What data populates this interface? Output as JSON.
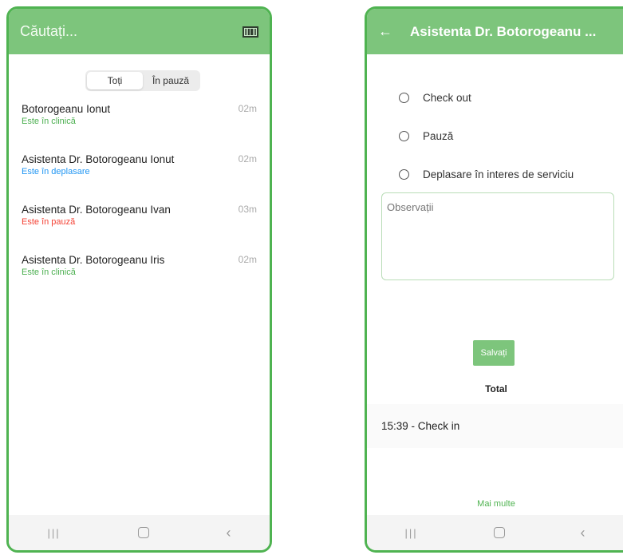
{
  "left_screen": {
    "search": {
      "placeholder": "Căutați..."
    },
    "icons": {
      "scan": "barcode-scan-icon"
    },
    "filter_tabs": [
      {
        "label": "Toți",
        "active": true
      },
      {
        "label": "În pauză",
        "active": false
      }
    ],
    "people": [
      {
        "name": "Botorogeanu Ionut",
        "status": "Este în clinică",
        "status_color": "#4caf50",
        "time": "02m"
      },
      {
        "name": "Asistenta Dr. Botorogeanu Ionut",
        "status": "Este în deplasare",
        "status_color": "#2196f3",
        "time": "02m"
      },
      {
        "name": "Asistenta Dr. Botorogeanu Ivan",
        "status": "Este în pauză",
        "status_color": "#f44336",
        "time": "03m"
      },
      {
        "name": "Asistenta  Dr. Botorogeanu Iris",
        "status": "Este în clinică",
        "status_color": "#4caf50",
        "time": "02m"
      }
    ],
    "nav": {
      "recents": "|||",
      "home": "",
      "back": "‹"
    }
  },
  "right_screen": {
    "title": "Asistenta  Dr. Botorogeanu ...",
    "back_glyph": "←",
    "options": [
      {
        "label": "Check out"
      },
      {
        "label": "Pauză"
      },
      {
        "label": "Deplasare în interes de serviciu"
      }
    ],
    "observations_placeholder": "Observații",
    "save_label": "Salvați",
    "total_label": "Total",
    "entries": [
      "15:39 - Check in"
    ],
    "more_label": "Mai multe",
    "nav": {
      "recents": "|||",
      "home": "",
      "back": "‹"
    }
  },
  "colors": {
    "accent": "#7dc57c",
    "frame": "#4fb351"
  }
}
